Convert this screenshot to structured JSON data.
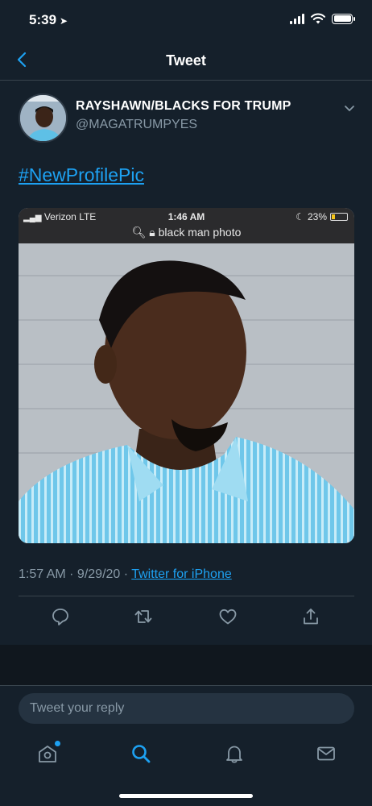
{
  "status_bar": {
    "time": "5:39"
  },
  "nav": {
    "title": "Tweet"
  },
  "tweet": {
    "author_name": "RAYSHAWN/BLACKS FOR TRUMP",
    "author_handle": "@MAGATRUMPYES",
    "hashtag": "#NewProfilePic",
    "media": {
      "carrier": "Verizon",
      "network": "LTE",
      "time": "1:46 AM",
      "battery": "23%",
      "url_text": "black man photo"
    },
    "timestamp": "1:57 AM · 9/29/20 · ",
    "source": "Twitter for iPhone"
  },
  "reply": {
    "placeholder": "Tweet your reply"
  },
  "colors": {
    "background": "#15202b",
    "accent": "#1da1f2",
    "secondary_text": "#8899a6",
    "border": "#38444d"
  }
}
